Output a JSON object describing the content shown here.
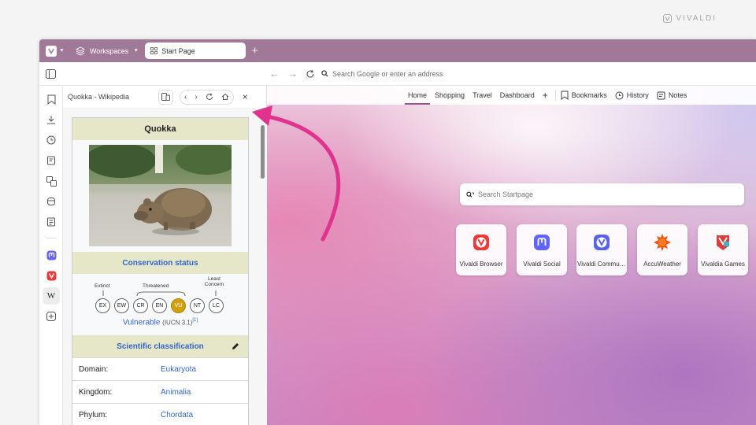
{
  "brand": {
    "name": "VIVALDI"
  },
  "tabbar": {
    "workspaces_label": "Workspaces",
    "active_tab_title": "Start Page",
    "new_tab_symbol": "+"
  },
  "addressbar": {
    "placeholder": "Search Google or enter an address"
  },
  "web_panel": {
    "title": "Quokka - Wikipedia",
    "close_symbol": "×"
  },
  "infobox": {
    "title": "Quokka",
    "conservation_heading": "Conservation status",
    "scale": {
      "extinct_label": "Extinct",
      "threatened_label": "Threatened",
      "least_concern_label": "Least Concern",
      "codes": [
        "EX",
        "EW",
        "CR",
        "EN",
        "VU",
        "NT",
        "LC"
      ],
      "highlighted": "VU"
    },
    "status_text": "Vulnerable",
    "status_source": "(IUCN 3.1)",
    "status_ref": "[1]",
    "classification_heading": "Scientific classification",
    "taxonomy": [
      {
        "rank": "Domain:",
        "value": "Eukaryota"
      },
      {
        "rank": "Kingdom:",
        "value": "Animalia"
      },
      {
        "rank": "Phylum:",
        "value": "Chordata"
      }
    ]
  },
  "startpage": {
    "nav": [
      "Home",
      "Shopping",
      "Travel",
      "Dashboard"
    ],
    "add_symbol": "+",
    "links": {
      "bookmarks": "Bookmarks",
      "history": "History",
      "notes": "Notes"
    },
    "search_placeholder": "Search Startpage",
    "speed_dials": [
      {
        "label": "Vivaldi Browser",
        "icon": "vivaldi-icon",
        "color": "#ef3939"
      },
      {
        "label": "Vivaldi Social",
        "icon": "mastodon-icon",
        "color": "#6364ff"
      },
      {
        "label": "Vivaldi Community",
        "icon": "vivaldi-community-icon",
        "color": "#5a63e8"
      },
      {
        "label": "AccuWeather",
        "icon": "sun-icon",
        "color": "#f05514"
      },
      {
        "label": "Vivaldia Games",
        "icon": "vivaldia-games-icon",
        "color": "#e23a3a"
      }
    ]
  },
  "colors": {
    "tabbar": "#a07999",
    "accent": "#a0578f",
    "arrow": "#e0338f",
    "infobox_header": "#e6e6c8",
    "link": "#3366cc",
    "vu_badge": "#d0a010"
  }
}
